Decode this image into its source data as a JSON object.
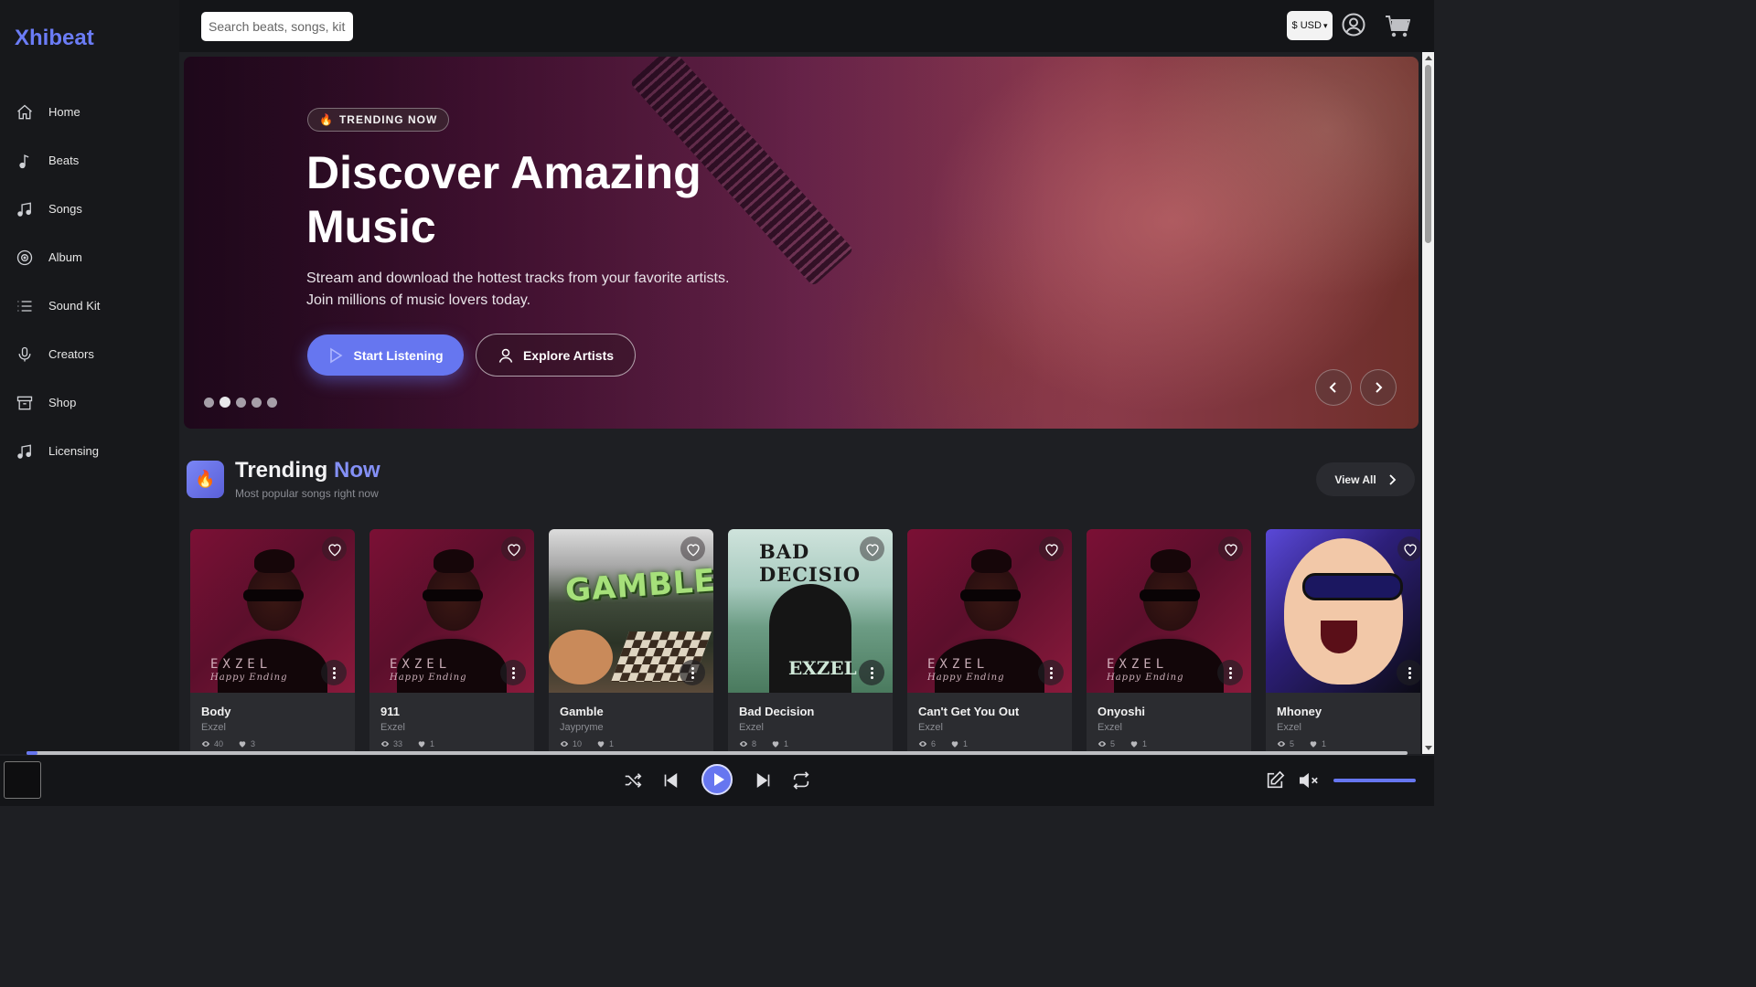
{
  "app": {
    "logo": "Xhibeat"
  },
  "sidebar": {
    "items": [
      {
        "label": "Home",
        "icon": "home-icon"
      },
      {
        "label": "Beats",
        "icon": "music-note-icon"
      },
      {
        "label": "Songs",
        "icon": "music-notes-icon"
      },
      {
        "label": "Album",
        "icon": "disc-icon"
      },
      {
        "label": "Sound Kit",
        "icon": "list-icon"
      },
      {
        "label": "Creators",
        "icon": "microphone-icon"
      },
      {
        "label": "Shop",
        "icon": "archive-icon"
      },
      {
        "label": "Licensing",
        "icon": "music-notes-icon"
      }
    ]
  },
  "topbar": {
    "search_placeholder": "Search beats, songs, kit",
    "currency": "$ USD"
  },
  "hero": {
    "badge": "TRENDING NOW",
    "badge_emoji": "🔥",
    "title": "Discover Amazing Music",
    "subtitle": "Stream and download the hottest tracks from your favorite artists. Join millions of music lovers today.",
    "primary_button": "Start Listening",
    "secondary_button": "Explore Artists",
    "slides_count": 5,
    "active_slide": 2
  },
  "trending": {
    "emoji": "🔥",
    "title_main": "Trending",
    "title_accent": "Now",
    "subtitle": "Most popular songs right now",
    "view_all": "View All",
    "cards": [
      {
        "title": "Body",
        "artist": "Exzel",
        "views": "40",
        "likes": "3",
        "cover": "exzel"
      },
      {
        "title": "911",
        "artist": "Exzel",
        "views": "33",
        "likes": "1",
        "cover": "exzel"
      },
      {
        "title": "Gamble",
        "artist": "Jaypryme",
        "views": "10",
        "likes": "1",
        "cover": "gamble"
      },
      {
        "title": "Bad Decision",
        "artist": "Exzel",
        "views": "8",
        "likes": "1",
        "cover": "bad"
      },
      {
        "title": "Can't Get You Out",
        "artist": "Exzel",
        "views": "6",
        "likes": "1",
        "cover": "exzel"
      },
      {
        "title": "Onyoshi",
        "artist": "Exzel",
        "views": "5",
        "likes": "1",
        "cover": "exzel"
      },
      {
        "title": "Mhoney",
        "artist": "Exzel",
        "views": "5",
        "likes": "1",
        "cover": "mhoney"
      }
    ],
    "cover_text": {
      "exzel_brand": "EXZEL",
      "exzel_sub": "Happy Ending",
      "gamble": "GAMBLE",
      "bad_top": "BAD DECISIO",
      "bad_bottom": "EXZEL"
    }
  },
  "player": {
    "progress_fraction": 0.008,
    "volume_fraction": 1.0
  },
  "colors": {
    "accent": "#6676f0",
    "sidebar_bg": "#17181b",
    "main_bg": "#1e1f23"
  }
}
